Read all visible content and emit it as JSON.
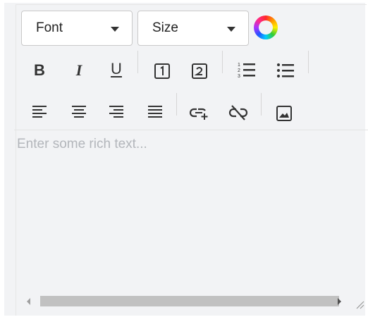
{
  "toolbar": {
    "font_select": {
      "value": "Font"
    },
    "size_select": {
      "value": "Size"
    },
    "color_picker": {
      "icon": "color-wheel-icon"
    },
    "bold_label": "B",
    "italic_label": "I",
    "underline_label": "U",
    "superscript_icon": "superscript-box-icon",
    "subscript_icon": "subscript-box-icon",
    "ordered_list_icon": "ordered-list-icon",
    "unordered_list_icon": "unordered-list-icon",
    "align_left_icon": "align-left-icon",
    "align_center_icon": "align-center-icon",
    "align_right_icon": "align-right-icon",
    "align_justify_icon": "align-justify-icon",
    "link_icon": "link-icon",
    "unlink_icon": "unlink-icon",
    "image_icon": "image-icon"
  },
  "editor": {
    "placeholder": "Enter some rich text..."
  },
  "colors": {
    "background": "#f2f3f5",
    "icon": "#333333",
    "placeholder": "#b3b6bb"
  }
}
